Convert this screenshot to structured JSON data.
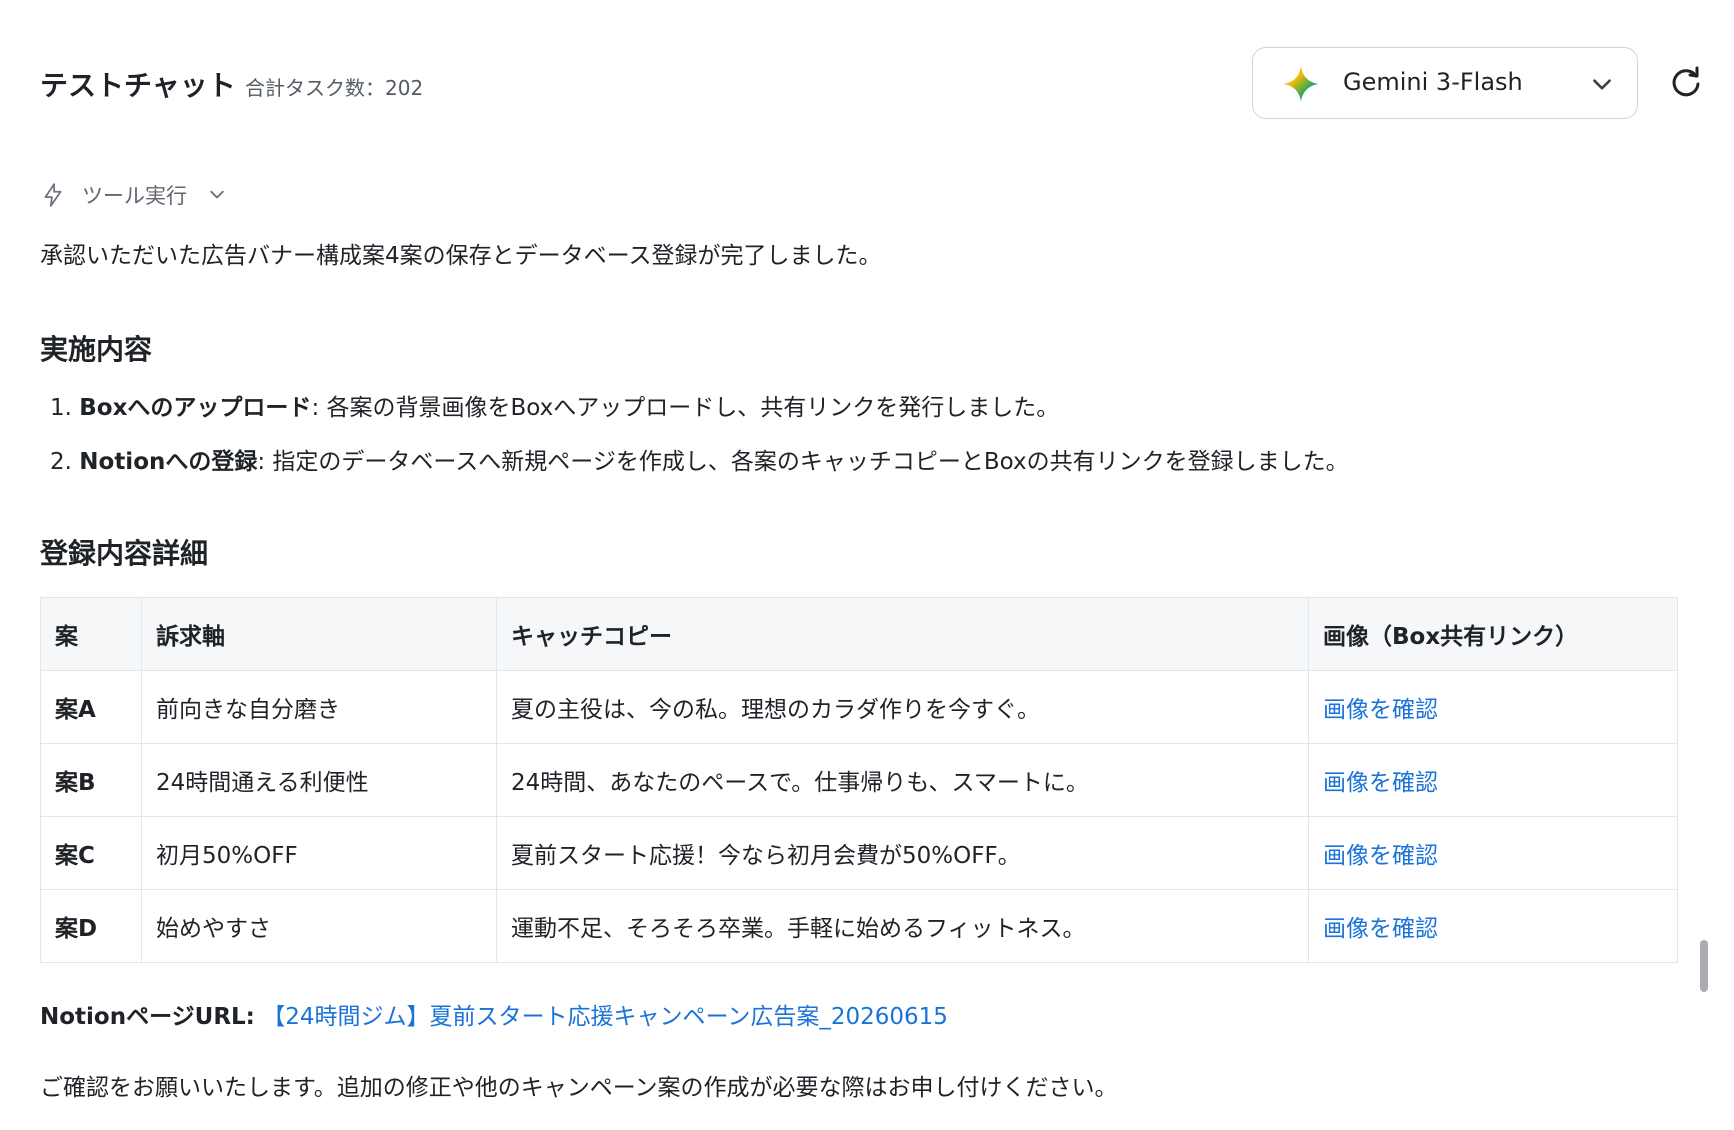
{
  "header": {
    "title": "テストチャット",
    "task_count": "合計タスク数：202",
    "model": "Gemini 3-Flash"
  },
  "tool_exec": {
    "label": "ツール実行"
  },
  "message": {
    "intro": "承認いただいた広告バナー構成案4案の保存とデータベース登録が完了しました。",
    "section1_title": "実施内容",
    "steps": [
      {
        "num": "1.",
        "bold": "Boxへのアップロード",
        "text": ": 各案の背景画像をBoxへアップロードし、共有リンクを発行しました。"
      },
      {
        "num": "2.",
        "bold": "Notionへの登録",
        "text": ": 指定のデータベースへ新規ページを作成し、各案のキャッチコピーとBoxの共有リンクを登録しました。"
      }
    ],
    "section2_title": "登録内容詳細",
    "table": {
      "headers": [
        "案",
        "訴求軸",
        "キャッチコピー",
        "画像（Box共有リンク）"
      ],
      "rows": [
        {
          "plan": "案A",
          "axis": "前向きな自分磨き",
          "copy": "夏の主役は、今の私。理想のカラダ作りを今すぐ。",
          "link": "画像を確認"
        },
        {
          "plan": "案B",
          "axis": "24時間通える利便性",
          "copy": "24時間、あなたのペースで。仕事帰りも、スマートに。",
          "link": "画像を確認"
        },
        {
          "plan": "案C",
          "axis": "初月50%OFF",
          "copy": "夏前スタート応援！今なら初月会費が50%OFF。",
          "link": "画像を確認"
        },
        {
          "plan": "案D",
          "axis": "始めやすさ",
          "copy": "運動不足、そろそろ卒業。手軽に始めるフィットネス。",
          "link": "画像を確認"
        }
      ]
    },
    "url_label": "NotionページURL:",
    "url_text": "【24時間ジム】夏前スタート応援キャンペーン広告案_20260615",
    "closing": "ご確認をお願いいたします。追加の修正や他のキャンペーン案の作成が必要な際はお申し付けください。"
  },
  "colors": {
    "link": "#1a73d9",
    "border": "#e3e6ea",
    "header_bg": "#f6f7f8"
  }
}
